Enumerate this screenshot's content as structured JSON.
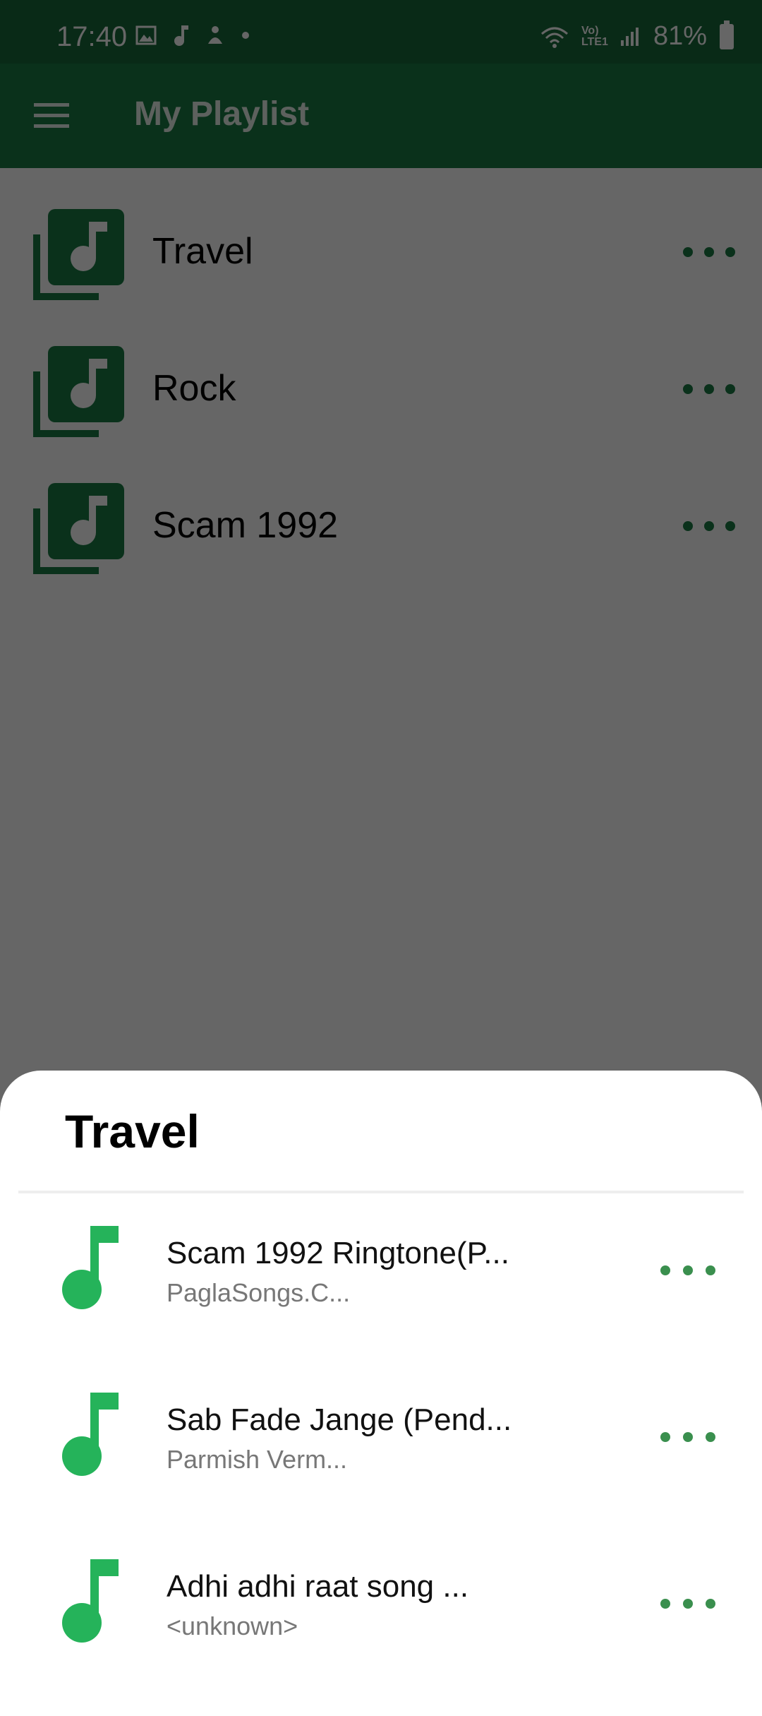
{
  "status_bar": {
    "time": "17:40",
    "battery": "81%",
    "network_label": "Vo) LTE1"
  },
  "app_bar": {
    "title": "My Playlist",
    "menu_icon": "hamburger-menu-icon"
  },
  "playlists": [
    {
      "name": "Travel"
    },
    {
      "name": "Rock"
    },
    {
      "name": "Scam 1992"
    }
  ],
  "sheet": {
    "title": "Travel",
    "songs": [
      {
        "title": "Scam 1992 Ringtone(P...",
        "artist": "PaglaSongs.C..."
      },
      {
        "title": "Sab Fade Jange (Pend...",
        "artist": "Parmish Verm..."
      },
      {
        "title": "Adhi adhi raat song ...",
        "artist": "<unknown>"
      }
    ]
  },
  "colors": {
    "primary": "#1b7b45",
    "status_bar": "#18693a",
    "accent_green": "#3a8f4e",
    "music_note": "#25b35a"
  }
}
